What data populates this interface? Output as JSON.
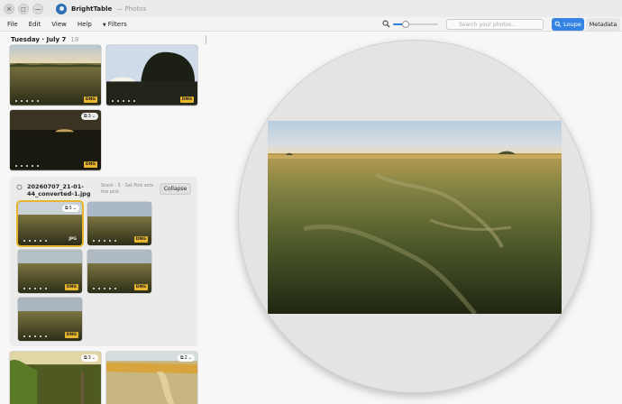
{
  "titlebar": {
    "app_name": "BrightTable",
    "subtitle": "— Photos",
    "close_glyph": "×",
    "restore_glyph": "◻",
    "minimize_glyph": "—"
  },
  "menu": {
    "file": "File",
    "edit": "Edit",
    "view": "View",
    "help": "Help",
    "filters": "Filters"
  },
  "toolbar": {
    "zoom_level": 0.28,
    "search_placeholder": "Search your photos...",
    "loupe_label": "Loupe",
    "metadata_label": "Metadata",
    "accent": "#3584e4"
  },
  "sidebar": {
    "date_title": "Tuesday · July 7",
    "date_count": "18",
    "photos": [
      {
        "badge": "DNG",
        "stars": 5
      },
      {
        "badge": "DNG",
        "stars": 5
      },
      {
        "badge": "DNG",
        "stars": 5,
        "stack": "3"
      }
    ],
    "stack": {
      "title": "20260707_21-01-44_converted-1.jpg",
      "description": "Stack · 5 · Set Pick sets the pick",
      "collapse_label": "Collapse",
      "photos": [
        {
          "badge": "JPG",
          "stars": 5,
          "stack": "5",
          "selected": true
        },
        {
          "badge": "DNG",
          "stars": 5
        },
        {
          "badge": "DNG",
          "stars": 5
        },
        {
          "badge": "DNG",
          "stars": 5
        },
        {
          "badge": "DNG",
          "stars": 5
        }
      ]
    },
    "lower_photos": [
      {
        "stack": "3"
      },
      {
        "stack": "2"
      }
    ]
  },
  "colors": {
    "raw_badge": "#e8b62c",
    "selected_border": "#e8b62c"
  }
}
